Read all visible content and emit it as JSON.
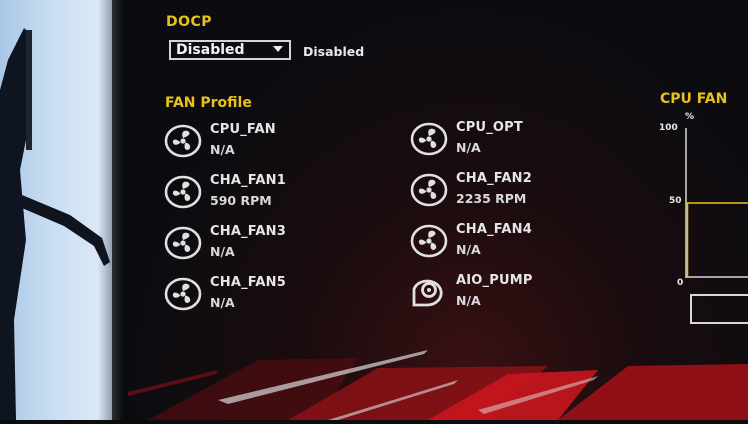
{
  "docp": {
    "title": "DOCP",
    "selected_value": "Disabled",
    "status_text": "Disabled"
  },
  "fan_profile": {
    "title": "FAN Profile",
    "fans": [
      {
        "name": "CPU_FAN",
        "value": "N/A",
        "icon": "fan-icon"
      },
      {
        "name": "CPU_OPT",
        "value": "N/A",
        "icon": "fan-icon"
      },
      {
        "name": "CHA_FAN1",
        "value": "590 RPM",
        "icon": "fan-icon"
      },
      {
        "name": "CHA_FAN2",
        "value": "2235 RPM",
        "icon": "fan-icon"
      },
      {
        "name": "CHA_FAN3",
        "value": "N/A",
        "icon": "fan-icon"
      },
      {
        "name": "CHA_FAN4",
        "value": "N/A",
        "icon": "fan-icon"
      },
      {
        "name": "CHA_FAN5",
        "value": "N/A",
        "icon": "fan-icon"
      },
      {
        "name": "AIO_PUMP",
        "value": "N/A",
        "icon": "pump-icon"
      }
    ]
  },
  "cpu_fan_graph": {
    "title": "CPU FAN",
    "y_unit": "%",
    "ticks": [
      "100",
      "50",
      "0"
    ],
    "level_percent": 50
  },
  "colors": {
    "accent": "#e8c21c",
    "text": "#e6e6e8",
    "background": "#0c0c10",
    "brand_red": "#c8161e"
  }
}
